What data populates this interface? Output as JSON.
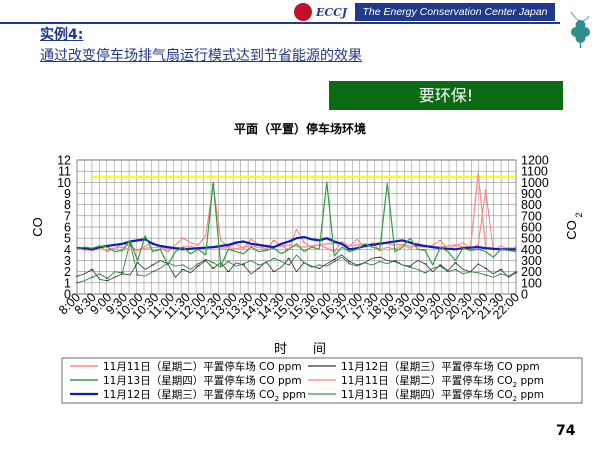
{
  "header": {
    "logo_text": "ECCJ",
    "org_name": "The Energy Conservation Center Japan"
  },
  "slide": {
    "title": "实例4:",
    "subtitle": "通过改变停车场排气扇运行模式达到节省能源的效果",
    "banner": "要环保!",
    "page_number": "74"
  },
  "colors": {
    "navy": "#1f3a8a",
    "green_banner": "#0b6b12",
    "threshold": "#ffff00"
  },
  "chart_data": {
    "type": "line",
    "title": "平面（平置）停车场环境",
    "xlabel": "时　　间",
    "ylabel_left": "CO",
    "ylabel_right_main": "CO",
    "ylabel_right_sub": "2",
    "ylim_left": [
      0,
      12
    ],
    "ylim_right": [
      0,
      1200
    ],
    "y_ticks_left": [
      "0",
      "1",
      "2",
      "3",
      "4",
      "5",
      "6",
      "7",
      "8",
      "9",
      "10",
      "11",
      "12"
    ],
    "y_ticks_right": [
      "0",
      "100",
      "200",
      "300",
      "400",
      "500",
      "600",
      "700",
      "800",
      "900",
      "1000",
      "1100",
      "1200"
    ],
    "x_ticks": [
      "8:00",
      "8:30",
      "9:00",
      "9:30",
      "10:00",
      "10:30",
      "11:00",
      "11:30",
      "12:00",
      "12:30",
      "13:00",
      "13:30",
      "14:00",
      "14:30",
      "15:00",
      "15:30",
      "16:00",
      "16:30",
      "17:00",
      "17:30",
      "18:00",
      "18:30",
      "19:00",
      "19:30",
      "20:00",
      "20:30",
      "21:00",
      "21:30",
      "22:00"
    ],
    "threshold": {
      "axis": "right",
      "value": 1050
    },
    "series": [
      {
        "name_main": "11月11日（星期二）平置停车场 CO ppm",
        "name_sub": "",
        "name_tail": "",
        "axis": "left",
        "color": "#ff7070",
        "width": 0.9,
        "values": [
          4.2,
          3.9,
          4.0,
          4.3,
          3.8,
          4.1,
          4.5,
          4.3,
          3.9,
          4.3,
          4.6,
          4.1,
          3.8,
          4.4,
          5.0,
          4.6,
          4.4,
          5.2,
          9.8,
          4.8,
          4.2,
          4.5,
          4.1,
          4.9,
          4.4,
          4.0,
          4.8,
          4.3,
          4.0,
          5.8,
          4.6,
          4.2,
          4.4,
          4.1,
          3.8,
          4.7,
          4.3,
          4.9,
          4.2,
          4.6,
          3.9,
          4.2,
          4.0,
          4.4,
          4.1,
          4.6,
          4.2,
          4.4,
          4.8,
          4.0,
          4.3,
          4.6,
          4.1,
          4.4,
          9.3,
          3.9,
          4.3,
          4.0,
          4.2
        ]
      },
      {
        "name_main": "11月12日（星期三）平置停车场 CO ppm",
        "name_sub": "",
        "name_tail": "",
        "axis": "left",
        "color": "#333333",
        "width": 0.8,
        "values": [
          1.6,
          1.8,
          2.2,
          1.3,
          1.2,
          1.5,
          1.8,
          1.7,
          2.8,
          2.2,
          2.6,
          3.0,
          2.7,
          1.5,
          2.2,
          1.9,
          2.5,
          3.0,
          2.3,
          2.8,
          2.0,
          2.8,
          2.6,
          1.8,
          2.3,
          2.9,
          2.0,
          2.4,
          3.2,
          2.0,
          2.8,
          2.5,
          2.3,
          2.7,
          3.1,
          3.5,
          2.9,
          2.6,
          2.8,
          3.2,
          3.3,
          3.0,
          2.9,
          2.6,
          2.5,
          3.0,
          2.7,
          2.0,
          2.6,
          2.1,
          2.8,
          2.2,
          2.0,
          2.7,
          2.3,
          1.8,
          2.2,
          1.5,
          1.9
        ]
      },
      {
        "name_main": "11月13日（星期四）平置停车场 CO ppm",
        "name_sub": "",
        "name_tail": "",
        "axis": "left",
        "color": "#1a7a2e",
        "width": 0.8,
        "values": [
          1.0,
          1.2,
          1.5,
          1.8,
          1.4,
          2.0,
          1.9,
          4.6,
          1.7,
          1.6,
          2.0,
          2.3,
          2.8,
          2.5,
          2.6,
          2.2,
          2.7,
          3.1,
          2.8,
          2.4,
          2.9,
          2.5,
          2.7,
          3.0,
          2.6,
          2.8,
          3.2,
          2.9,
          2.6,
          3.5,
          2.8,
          2.4,
          2.6,
          2.5,
          2.9,
          3.3,
          2.7,
          2.5,
          2.8,
          2.6,
          2.9,
          2.7,
          3.0,
          2.6,
          2.4,
          2.2,
          1.9,
          2.3,
          2.5,
          2.0,
          2.2,
          1.8,
          2.0,
          1.9,
          1.7,
          1.5,
          1.8,
          1.6,
          2.0
        ]
      },
      {
        "name_main": "11月11日（星期二）平置停车场 CO",
        "name_sub": "2",
        "name_tail": " ppm",
        "axis": "right",
        "color": "#ff9090",
        "width": 1.4,
        "values": [
          410,
          400,
          390,
          405,
          395,
          410,
          420,
          400,
          390,
          410,
          415,
          420,
          405,
          410,
          420,
          425,
          410,
          415,
          420,
          410,
          415,
          405,
          420,
          430,
          415,
          410,
          420,
          430,
          440,
          425,
          420,
          430,
          440,
          450,
          455,
          445,
          430,
          440,
          445,
          450,
          460,
          450,
          440,
          445,
          430,
          425,
          420,
          425,
          420,
          430,
          440,
          420,
          425,
          1080,
          420,
          410,
          400,
          415,
          405
        ]
      },
      {
        "name_main": "11月12日（星期三）平置停车场 CO",
        "name_sub": "2",
        "name_tail": " ppm",
        "axis": "right",
        "color": "#0b1fb8",
        "width": 2.2,
        "values": [
          410,
          410,
          400,
          420,
          430,
          440,
          450,
          470,
          480,
          490,
          450,
          430,
          420,
          410,
          400,
          405,
          410,
          415,
          420,
          430,
          440,
          460,
          470,
          450,
          440,
          430,
          420,
          450,
          470,
          500,
          510,
          490,
          480,
          500,
          470,
          450,
          400,
          410,
          430,
          440,
          450,
          460,
          470,
          480,
          460,
          440,
          430,
          420,
          410,
          405,
          400,
          410,
          415,
          420,
          410,
          405,
          400,
          400,
          400
        ]
      },
      {
        "name_main": "11月13日（星期四）平置停车场 CO",
        "name_sub": "2",
        "name_tail": " ppm",
        "axis": "right",
        "color": "#2f9e3e",
        "width": 1.2,
        "values": [
          400,
          420,
          410,
          430,
          420,
          380,
          390,
          480,
          300,
          520,
          380,
          400,
          260,
          380,
          420,
          360,
          400,
          350,
          1000,
          250,
          400,
          380,
          360,
          420,
          380,
          390,
          410,
          360,
          400,
          450,
          380,
          420,
          400,
          1000,
          340,
          420,
          380,
          400,
          450,
          420,
          400,
          990,
          380,
          420,
          500,
          400,
          390,
          260,
          420,
          380,
          300,
          410,
          390,
          400,
          380,
          330,
          400,
          390,
          380
        ]
      }
    ]
  }
}
